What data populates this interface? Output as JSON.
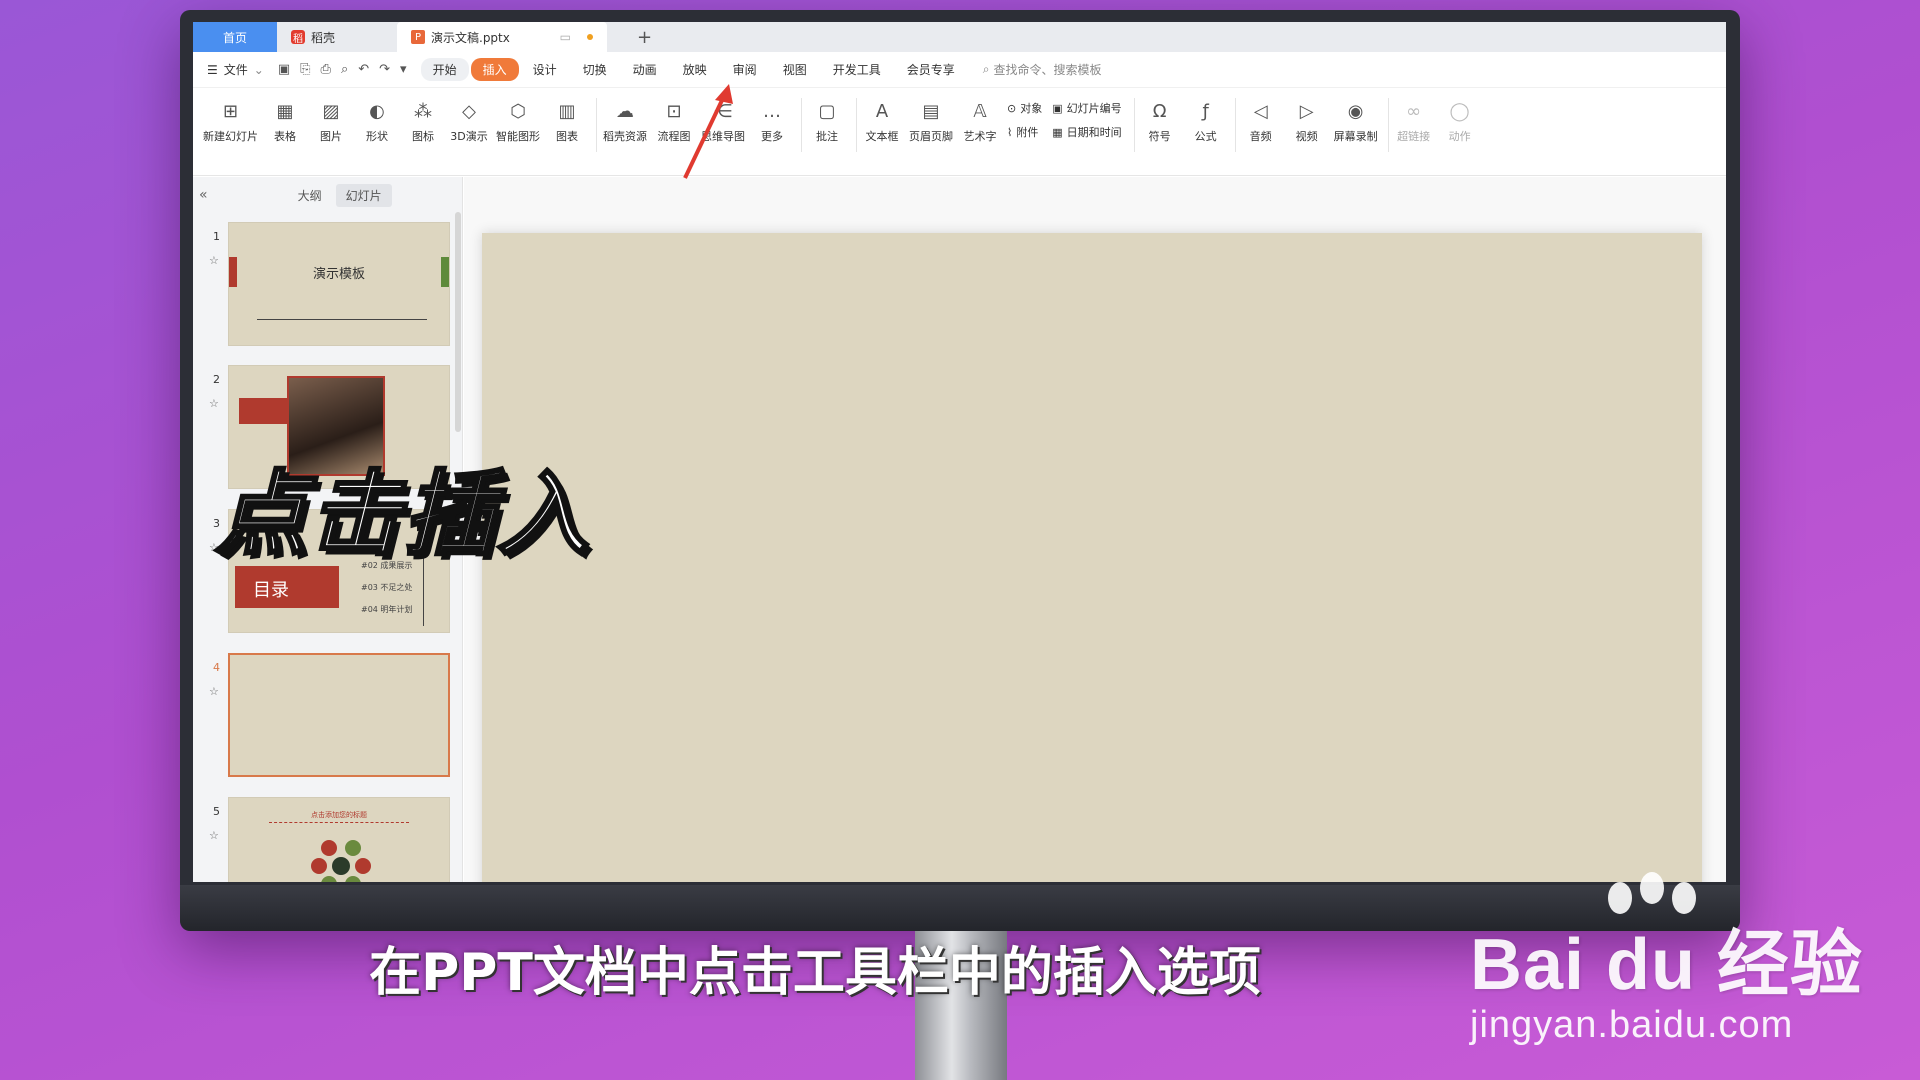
{
  "tabs": {
    "home": "首页",
    "daoke": "稻壳",
    "doc": "演示文稿.pptx",
    "add": "+"
  },
  "menu": {
    "file": "文件",
    "items": [
      "开始",
      "插入",
      "设计",
      "切换",
      "动画",
      "放映",
      "审阅",
      "视图",
      "开发工具",
      "会员专享"
    ],
    "active_index": 1,
    "search_placeholder": "查找命令、搜索模板"
  },
  "ribbon": {
    "new_slide": "新建幻灯片",
    "table": "表格",
    "picture": "图片",
    "shape": "形状",
    "icon": "图标",
    "model3d": "3D演示",
    "smartart": "智能图形",
    "chart": "图表",
    "daoke_res": "稻壳资源",
    "flowchart": "流程图",
    "mindmap": "思维导图",
    "more": "更多",
    "comment": "批注",
    "textbox": "文本框",
    "header_footer": "页眉页脚",
    "wordart": "艺术字",
    "object": "对象",
    "attachment": "附件",
    "slide_number": "幻灯片编号",
    "datetime": "日期和时间",
    "symbol": "符号",
    "formula": "公式",
    "audio": "音频",
    "video": "视频",
    "screen_record": "屏幕录制",
    "hyperlink": "超链接",
    "action": "动作"
  },
  "sidebar": {
    "collapse": "«",
    "tab_outline": "大纲",
    "tab_slides": "幻灯片",
    "slides": [
      {
        "num": "1",
        "title": "演示模板"
      },
      {
        "num": "2"
      },
      {
        "num": "3",
        "title": "目录",
        "items": [
          "#02 成果展示",
          "#03 不足之处",
          "#04 明年计划"
        ]
      },
      {
        "num": "4"
      },
      {
        "num": "5",
        "title": "点击添加您的标题"
      }
    ]
  },
  "overlay": {
    "big_caption": "点击插入",
    "subtitle": "在PPT文档中点击工具栏中的插入选项",
    "watermark_logo": "Bai du 经验",
    "watermark_url": "jingyan.baidu.com"
  },
  "colors": {
    "accent": "#f07a3a",
    "slide_bg": "#ddd6c0",
    "thumb_red": "#b03a2e",
    "background": "#b04fd0"
  }
}
